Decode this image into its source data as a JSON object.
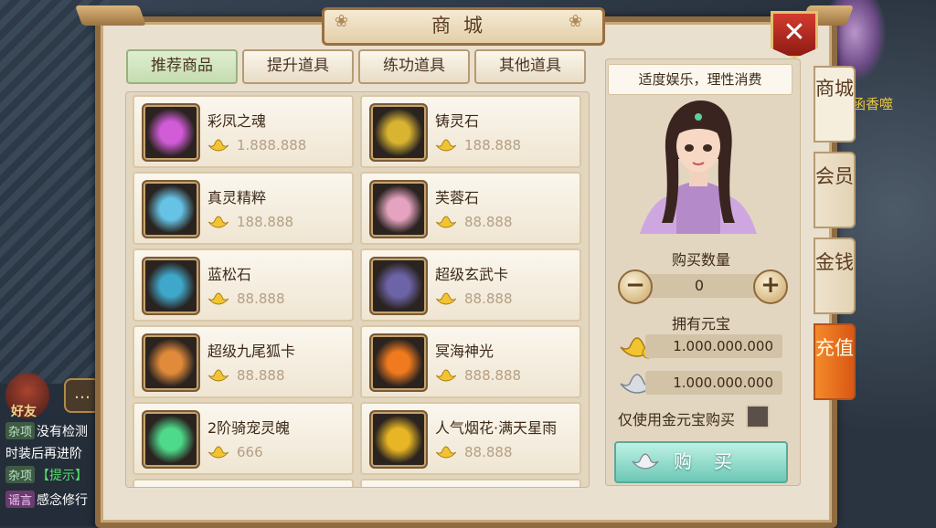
{
  "header": {
    "title": "商城",
    "close_label": "✕"
  },
  "tabs": [
    {
      "label": "推荐商品",
      "active": true
    },
    {
      "label": "提升道具",
      "active": false
    },
    {
      "label": "练功道具",
      "active": false
    },
    {
      "label": "其他道具",
      "active": false
    }
  ],
  "items": [
    {
      "name": "彩凤之魂",
      "price": "1.888.888",
      "icon": "phoenix-soul-icon",
      "color": "#d25bd8"
    },
    {
      "name": "铸灵石",
      "price": "188.888",
      "icon": "casting-stone-icon",
      "color": "#d9b431"
    },
    {
      "name": "真灵精粹",
      "price": "188.888",
      "icon": "spirit-essence-icon",
      "color": "#66c3e6"
    },
    {
      "name": "芙蓉石",
      "price": "88.888",
      "icon": "rose-quartz-icon",
      "color": "#e5a3c0"
    },
    {
      "name": "蓝松石",
      "price": "88.888",
      "icon": "turquoise-icon",
      "color": "#3fa7c9"
    },
    {
      "name": "超级玄武卡",
      "price": "88.888",
      "icon": "xuanwu-card-icon",
      "color": "#6d64a8"
    },
    {
      "name": "超级九尾狐卡",
      "price": "88.888",
      "icon": "nine-tail-fox-card-icon",
      "color": "#e08a3a"
    },
    {
      "name": "冥海神光",
      "price": "888.888",
      "icon": "divine-light-icon",
      "color": "#f07a1e"
    },
    {
      "name": "2阶骑宠灵魄",
      "price": "666",
      "icon": "mount-soul-icon",
      "color": "#4fd98a"
    },
    {
      "name": "人气烟花·满天星雨",
      "price": "88.888",
      "icon": "firework-icon",
      "color": "#e8b524"
    }
  ],
  "right_panel": {
    "notice": "适度娱乐，理性消费",
    "quantity_label": "购买数量",
    "quantity_value": "0",
    "minus": "−",
    "plus": "+",
    "owned_label": "拥有元宝",
    "gold_ingot": "1.000.000.000",
    "silver_ingot": "1.000.000.000",
    "gold_only_label": "仅使用金元宝购买",
    "buy_label": "购买"
  },
  "side_tabs": [
    {
      "label": "商城",
      "active": true
    },
    {
      "label": "会员",
      "active": false
    },
    {
      "label": "金钱",
      "active": false
    },
    {
      "label": "充值",
      "active": false
    }
  ],
  "chat": {
    "friends_label": "好友",
    "lines": [
      {
        "tag": "杂项",
        "text": "没有检测"
      },
      {
        "tag": "",
        "text": "时装后再进阶"
      },
      {
        "tag": "杂项",
        "text": "【提示】"
      },
      {
        "tag": "谣言",
        "text": "感念修行"
      }
    ]
  },
  "bg_name": "函香噬"
}
